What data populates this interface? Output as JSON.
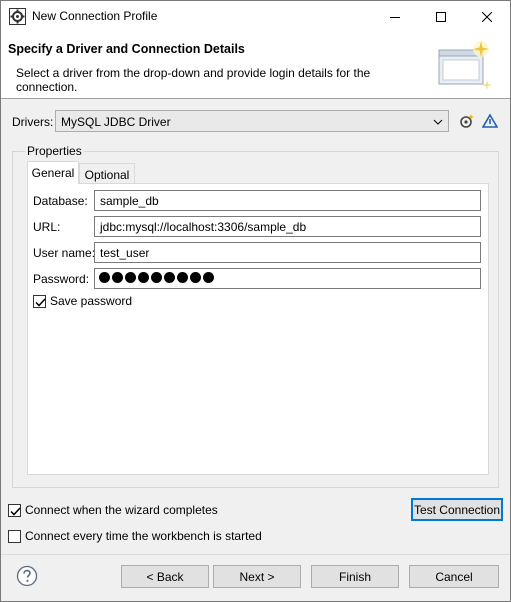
{
  "window": {
    "title": "New Connection Profile"
  },
  "banner": {
    "title": "Specify a Driver and Connection Details",
    "description": "Select a driver from the drop-down and provide login details for the connection."
  },
  "drivers": {
    "label": "Drivers:",
    "selected": "MySQL JDBC Driver"
  },
  "properties": {
    "group_label": "Properties",
    "tabs": [
      {
        "label": "General",
        "active": true
      },
      {
        "label": "Optional",
        "active": false
      }
    ],
    "fields": {
      "database_label": "Database:",
      "database_value": "sample_db",
      "url_label": "URL:",
      "url_value": "jdbc:mysql://localhost:3306/sample_db",
      "username_label": "User name:",
      "username_value": "test_user",
      "password_label": "Password:",
      "password_masked_count": 9
    },
    "save_password": {
      "label": "Save password",
      "checked": true
    }
  },
  "options": {
    "connect_on_complete": {
      "label": "Connect when the wizard completes",
      "checked": true
    },
    "connect_on_startup": {
      "label": "Connect every time the workbench is started",
      "checked": false
    }
  },
  "buttons": {
    "test_connection": "Test Connection",
    "back": "< Back",
    "next": "Next >",
    "finish": "Finish",
    "cancel": "Cancel"
  },
  "icons": {
    "app": "gear-app-icon",
    "help": "help-icon",
    "new_driver": "new-driver-icon",
    "edit_driver": "edit-driver-icon"
  },
  "colors": {
    "accent": "#0078d7",
    "background": "#f0f0f0"
  }
}
